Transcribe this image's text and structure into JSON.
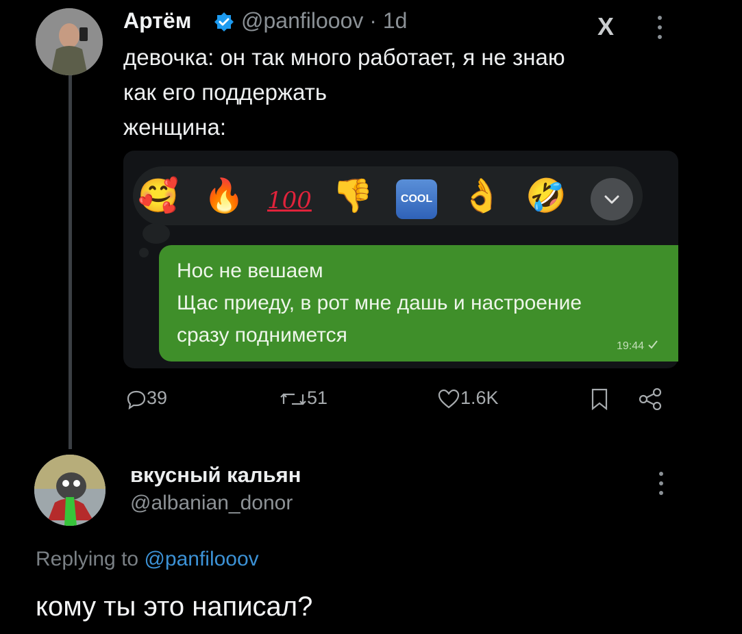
{
  "tweet": {
    "author_name": "Артём",
    "author_handle": "@panfilooov",
    "separator": "·",
    "age": "1d",
    "text": "девочка: он так много работает, я не знаю\nкак его поддержать\nженщина:",
    "platform_logo": "X",
    "embedded_screenshot": {
      "reactions": [
        {
          "icon": "smiling-face-with-hearts-icon",
          "glyph": "🥰"
        },
        {
          "icon": "fire-icon",
          "glyph": "🔥"
        },
        {
          "icon": "hundred-points-icon",
          "glyph": "100"
        },
        {
          "icon": "thumbs-down-icon",
          "glyph": "👎"
        },
        {
          "icon": "cool-button-icon",
          "glyph": "COOL"
        },
        {
          "icon": "ok-hand-icon",
          "glyph": "👌"
        },
        {
          "icon": "rolling-on-floor-laughing-icon",
          "glyph": "🤣"
        }
      ],
      "message_text": "Нос не вешаем\nЩас приеду, в рот мне дашь и настроение\nсразу поднимется",
      "message_time": "19:44"
    },
    "actions": {
      "replies": "39",
      "retweets": "51",
      "likes": "1.6K"
    }
  },
  "reply": {
    "author_name": "вкусный кальян",
    "author_handle": "@albanian_donor",
    "replying_prefix": "Replying to",
    "replying_to": "@panfilooov",
    "text": "кому ты это написал?"
  },
  "colors": {
    "background": "#000000",
    "bubble_green": "#3f8f2a",
    "verified_blue": "#1d9bf0",
    "link_blue": "#3c92d6",
    "muted_text": "#8b9196"
  }
}
